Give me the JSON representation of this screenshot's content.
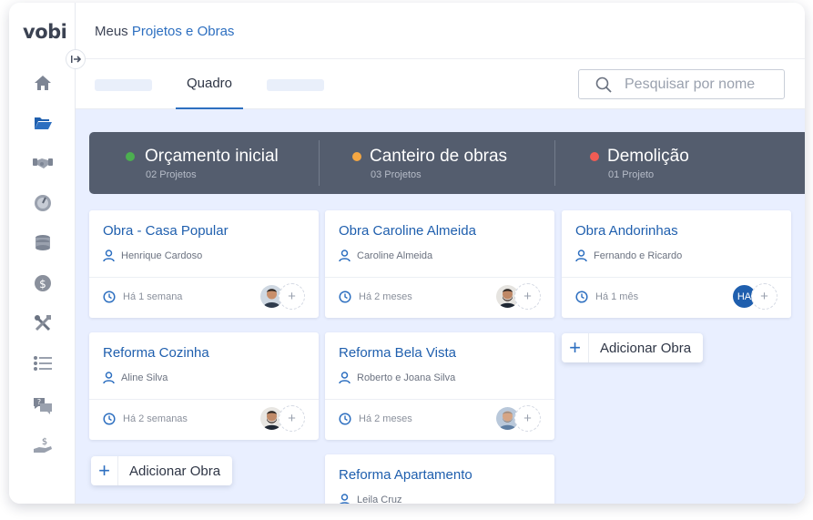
{
  "app": {
    "logo": "vobi"
  },
  "breadcrumb": {
    "prefix": "Meus",
    "current": "Projetos e Obras"
  },
  "tabs": {
    "active_label": "Quadro"
  },
  "search": {
    "placeholder": "Pesquisar por nome"
  },
  "sidebar": {
    "items": [
      {
        "icon": "home-icon"
      },
      {
        "icon": "folder-open-icon"
      },
      {
        "icon": "handshake-icon"
      },
      {
        "icon": "gauge-icon"
      },
      {
        "icon": "coins-stack-icon"
      },
      {
        "icon": "dollar-coin-icon"
      },
      {
        "icon": "tools-icon"
      },
      {
        "icon": "list-icon"
      },
      {
        "icon": "chat-help-icon"
      },
      {
        "icon": "hand-money-icon"
      }
    ]
  },
  "colors": {
    "accent": "#2d6fc0",
    "stage_bar": "#545d6e",
    "stage_green": "#4caf50",
    "stage_orange": "#f5a742",
    "stage_red": "#f25c54",
    "board_bg": "#e9efff"
  },
  "columns": [
    {
      "title": "Orçamento inicial",
      "count": "02 Projetos",
      "cards": [
        {
          "title": "Obra - Casa Popular",
          "owner": "Henrique Cardoso",
          "time": "Há 1 semana",
          "avatar": "photo",
          "add": "+"
        },
        {
          "title": "Reforma Cozinha",
          "owner": "Aline Silva",
          "time": "Há 2 semanas",
          "avatar": "photo",
          "add": "+"
        }
      ],
      "add_label": "Adicionar Obra"
    },
    {
      "title": "Canteiro de obras",
      "count": "03 Projetos",
      "cards": [
        {
          "title": "Obra Caroline Almeida",
          "owner": "Caroline Almeida",
          "time": "Há 2 meses",
          "avatar": "photo",
          "add": "+"
        },
        {
          "title": "Reforma Bela Vista",
          "owner": "Roberto e Joana Silva",
          "time": "Há 2 meses",
          "avatar": "photo",
          "add": "+"
        },
        {
          "title": "Reforma Apartamento",
          "owner": "Leila Cruz"
        }
      ]
    },
    {
      "title": "Demolição",
      "count": "01 Projeto",
      "cards": [
        {
          "title": "Obra Andorinhas",
          "owner": "Fernando e Ricardo",
          "time": "Há 1 mês",
          "avatar_initials": "HA",
          "add": "+"
        }
      ],
      "add_label": "Adicionar Obra"
    }
  ]
}
